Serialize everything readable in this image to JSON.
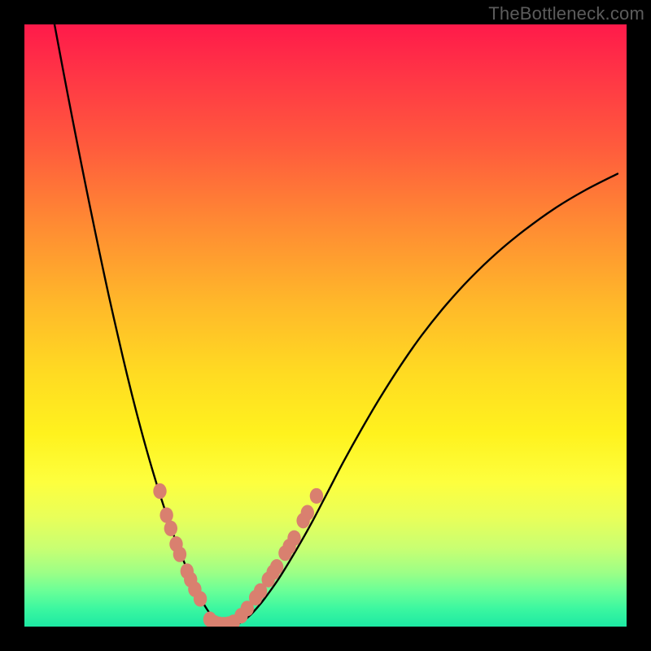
{
  "attribution": "TheBottleneck.com",
  "colors": {
    "background": "#000000",
    "curve": "#000000",
    "marker_fill": "#d9806f",
    "marker_stroke": "#d9806f",
    "gradient_stops": [
      "#ff1a4a",
      "#ff3446",
      "#ff5a3d",
      "#ff8a33",
      "#ffb72a",
      "#ffdb22",
      "#fff21e",
      "#fdff3e",
      "#e8ff5a",
      "#c8ff72",
      "#9dff86",
      "#6bff97",
      "#3cf7a0",
      "#1de9a3"
    ]
  },
  "chart_data": {
    "type": "line",
    "title": "",
    "xlabel": "",
    "ylabel": "",
    "xlim": [
      0,
      100
    ],
    "ylim": [
      0,
      100
    ],
    "x": [
      5.0,
      6.5,
      8.0,
      9.5,
      11.0,
      12.5,
      14.0,
      15.5,
      17.0,
      18.5,
      20.0,
      21.5,
      23.0,
      24.5,
      26.0,
      27.5,
      29.0,
      29.75,
      30.5,
      31.25,
      32.0,
      33.0,
      34.0,
      35.2,
      36.4,
      37.6,
      38.8,
      40.0,
      42.0,
      44.0,
      46.0,
      48.0,
      50.5,
      53.0,
      56.0,
      59.0,
      62.5,
      66.0,
      70.0,
      74.0,
      78.5,
      83.0,
      88.0,
      93.0,
      98.5
    ],
    "y": [
      100.0,
      92.0,
      84.2,
      76.6,
      69.2,
      62.0,
      55.0,
      48.4,
      42.0,
      36.0,
      30.4,
      25.2,
      20.4,
      16.0,
      12.0,
      8.4,
      5.2,
      3.8,
      2.6,
      1.6,
      0.9,
      0.35,
      0.1,
      0.35,
      1.0,
      2.0,
      3.3,
      4.8,
      7.6,
      10.8,
      14.2,
      17.8,
      22.6,
      27.4,
      32.8,
      37.9,
      43.4,
      48.4,
      53.4,
      57.8,
      62.1,
      65.8,
      69.4,
      72.4,
      75.2
    ],
    "markers": [
      {
        "x": 22.5,
        "y": 22.5
      },
      {
        "x": 23.6,
        "y": 18.5
      },
      {
        "x": 24.3,
        "y": 16.3
      },
      {
        "x": 25.2,
        "y": 13.7
      },
      {
        "x": 25.8,
        "y": 12.0
      },
      {
        "x": 27.0,
        "y": 9.2
      },
      {
        "x": 27.6,
        "y": 7.8
      },
      {
        "x": 28.3,
        "y": 6.2
      },
      {
        "x": 29.2,
        "y": 4.6
      },
      {
        "x": 30.8,
        "y": 1.2
      },
      {
        "x": 31.6,
        "y": 0.6
      },
      {
        "x": 32.4,
        "y": 0.35
      },
      {
        "x": 33.1,
        "y": 0.3
      },
      {
        "x": 33.9,
        "y": 0.4
      },
      {
        "x": 34.7,
        "y": 0.7
      },
      {
        "x": 36.0,
        "y": 1.8
      },
      {
        "x": 37.0,
        "y": 3.0
      },
      {
        "x": 38.4,
        "y": 4.8
      },
      {
        "x": 39.2,
        "y": 5.9
      },
      {
        "x": 40.5,
        "y": 7.8
      },
      {
        "x": 41.3,
        "y": 9.0
      },
      {
        "x": 41.9,
        "y": 9.9
      },
      {
        "x": 43.3,
        "y": 12.2
      },
      {
        "x": 44.0,
        "y": 13.3
      },
      {
        "x": 44.8,
        "y": 14.7
      },
      {
        "x": 46.3,
        "y": 17.6
      },
      {
        "x": 47.0,
        "y": 18.9
      },
      {
        "x": 48.5,
        "y": 21.7
      }
    ]
  }
}
